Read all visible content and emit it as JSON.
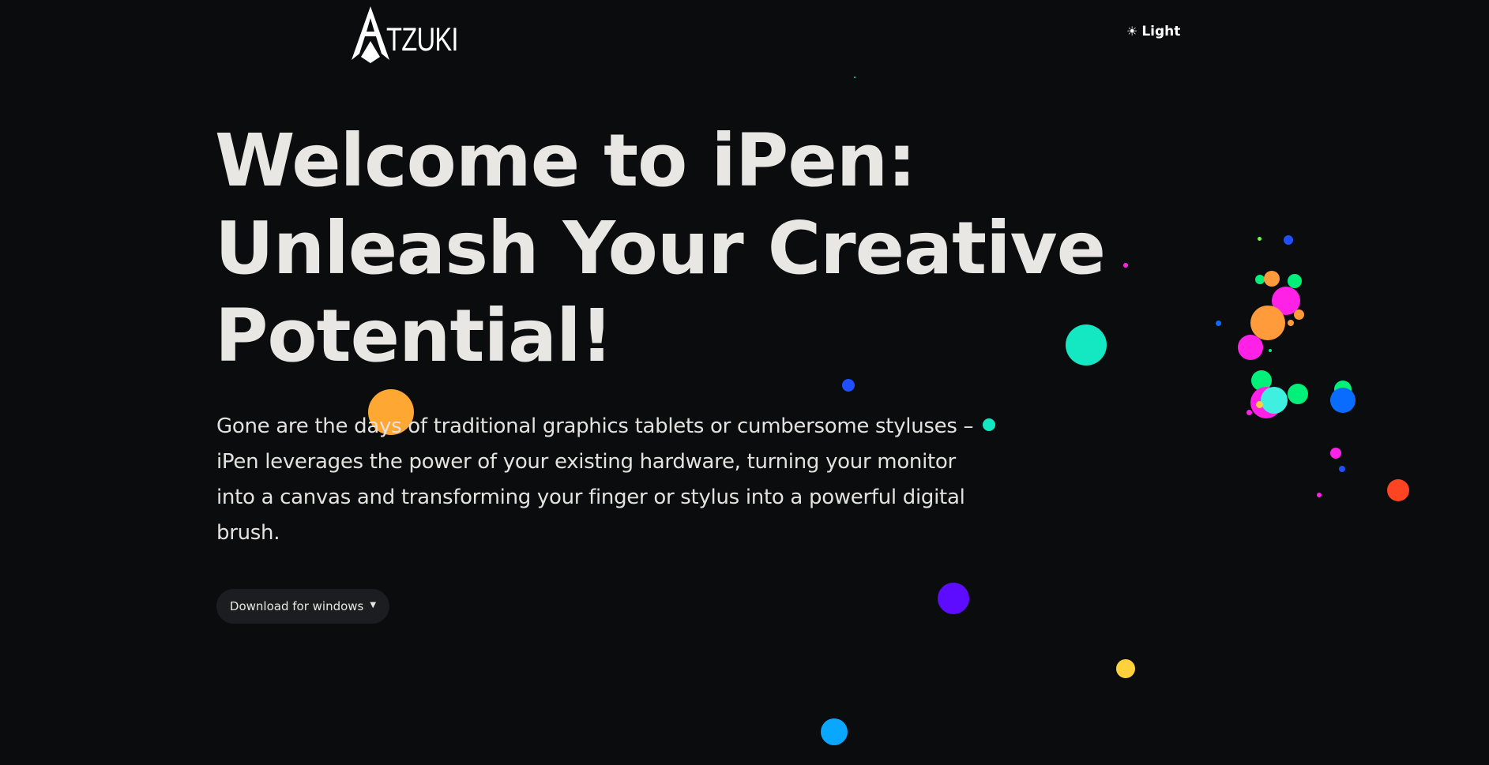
{
  "header": {
    "logo_text": "TZUKI",
    "theme_toggle_label": "Light",
    "theme_toggle_icon": "sun-icon"
  },
  "hero": {
    "title_lines": [
      "Welcome to iPen:",
      "Unleash Your Creative",
      "Potential!"
    ],
    "description": "Gone are the days of traditional graphics tablets or cumbersome styluses – iPen leverages the power of your existing hardware, turning your monitor into a canvas and transforming your finger or stylus into a powerful digital brush.",
    "download_label": "Download for windows",
    "download_icon": "chevron-down-icon"
  },
  "colors": {
    "background": "#0b0c0e",
    "text": "#e9e7e3",
    "button_bg": "#1c1d20",
    "particle_palette": [
      "#ffa733",
      "#1f4fff",
      "#14e8c3",
      "#00f07a",
      "#ff22e6",
      "#ff9b3a",
      "#5d0cff",
      "#ffd23d",
      "#09a7ff",
      "#ff4422",
      "#0a6cff",
      "#3ff0e0"
    ]
  }
}
